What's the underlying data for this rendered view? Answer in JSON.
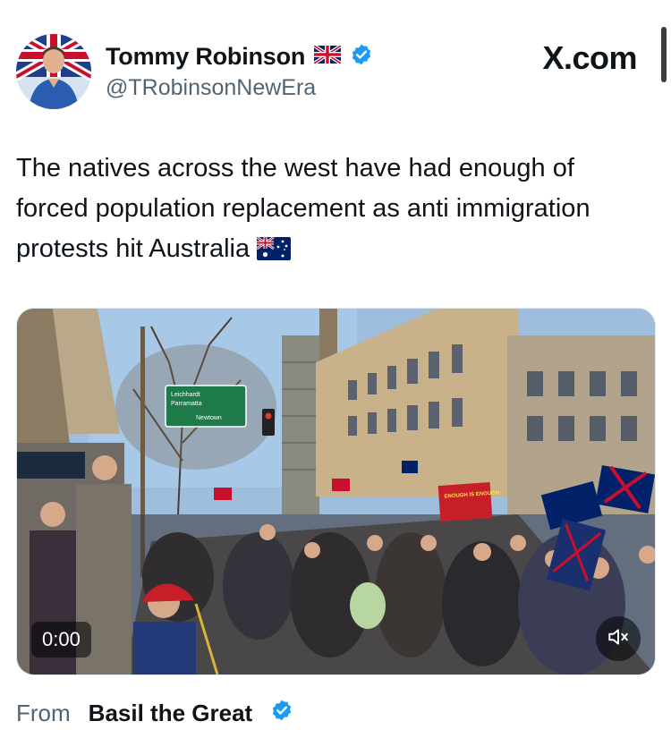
{
  "tweet": {
    "author": {
      "display_name": "Tommy Robinson",
      "handle": "@TRobinsonNewEra",
      "flag_icon": "uk-flag-icon",
      "verified": true
    },
    "brand": "X.com",
    "text": "The natives across the west have had enough of forced population replacement as anti immigration protests hit Australia",
    "text_flag_icon": "australia-flag-icon",
    "media": {
      "type": "video",
      "time": "0:00",
      "muted_icon": "speaker-muted-icon",
      "scene_signs": {
        "street_sign_line1": "Leichhardt",
        "street_sign_line2": "Parramatta",
        "street_sign_line3": "Newtown",
        "protest_banner": "ENOUGH IS ENOUGH"
      }
    },
    "source": {
      "prefix": "From",
      "name": "Basil the Great",
      "verified": true
    }
  },
  "colors": {
    "verified_blue": "#1d9bf0",
    "secondary_text": "#536471",
    "primary_text": "#0f1419"
  }
}
